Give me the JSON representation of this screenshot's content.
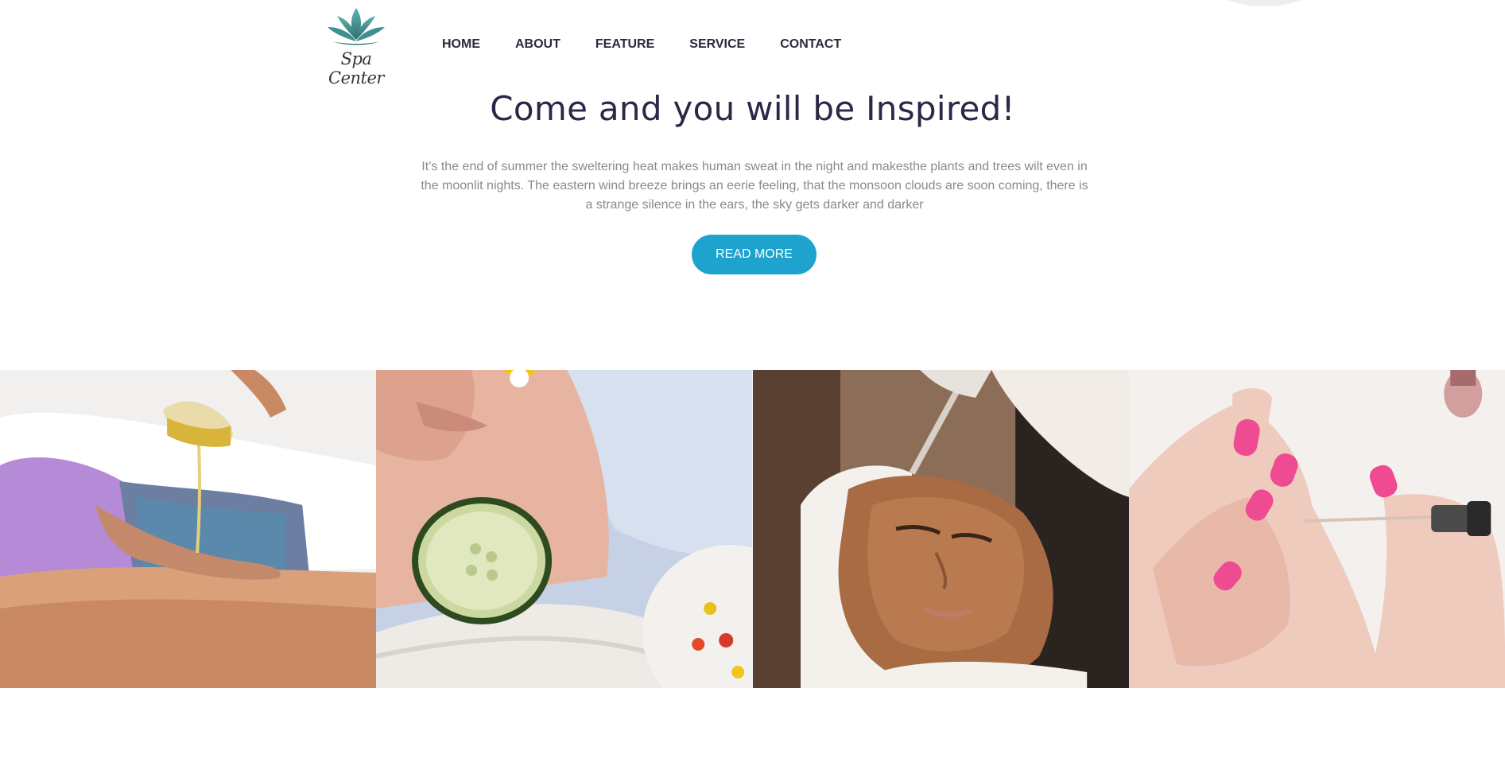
{
  "brand": {
    "name": "Spa Center",
    "accent": "#1ea3cf",
    "heading_color": "#2e2547",
    "logo_color": "#3f8f8f"
  },
  "nav": {
    "items": [
      {
        "label": "HOME"
      },
      {
        "label": "ABOUT"
      },
      {
        "label": "FEATURE"
      },
      {
        "label": "SERVICE"
      },
      {
        "label": "CONTACT"
      }
    ]
  },
  "hero": {
    "title": "Come and you will be Inspired!",
    "body": "It’s the end of summer the sweltering heat makes human sweat in the night and makesthe plants and trees wilt even in the moonlit nights. The eastern wind breeze brings an eerie feeling, that the monsoon clouds are soon coming, there is a strange silence in the ears, the sky gets darker and darker",
    "button_label": "READ MORE"
  },
  "gallery": {
    "images": [
      {
        "name": "massage-oil-photo"
      },
      {
        "name": "cucumber-facial-photo"
      },
      {
        "name": "clay-mask-photo"
      },
      {
        "name": "manicure-photo"
      }
    ]
  }
}
